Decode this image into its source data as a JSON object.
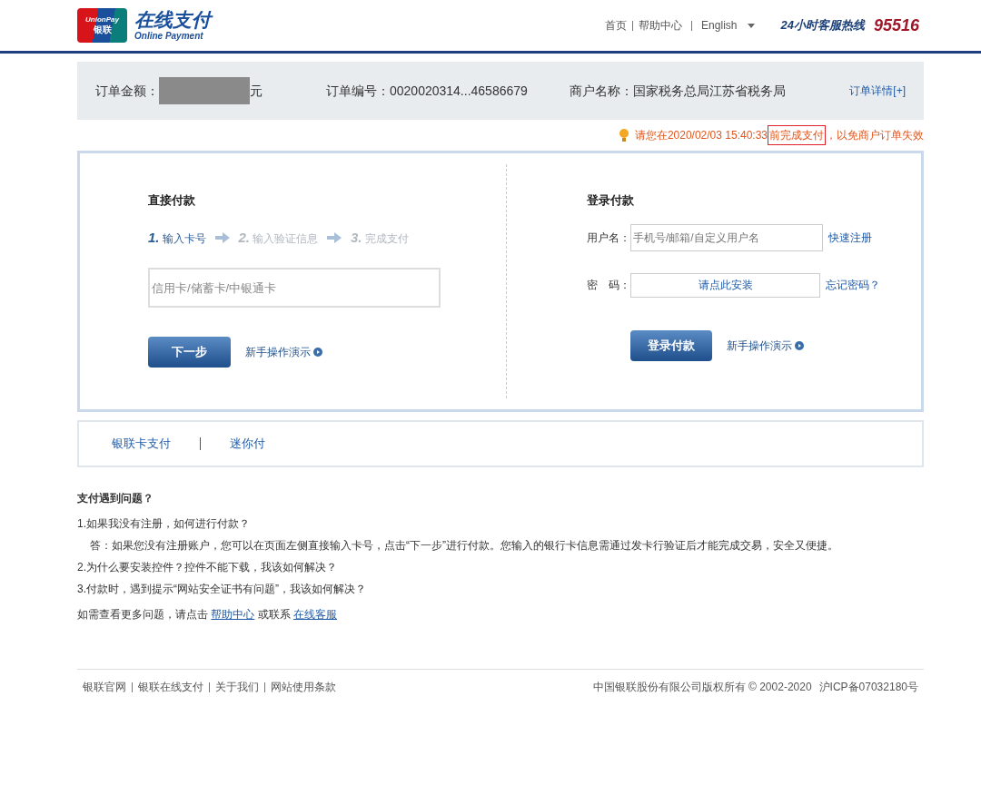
{
  "header": {
    "logo": {
      "mark_top": "UnionPay",
      "mark_bottom": "银联",
      "title": "在线支付",
      "subtitle": "Online Payment"
    },
    "nav": [
      "首页",
      "帮助中心"
    ],
    "language": "English",
    "hotline_label": "24小时客服热线",
    "hotline": "95516"
  },
  "order": {
    "amount_label": "订单金额：",
    "amount_unit": "元",
    "number_label": "订单编号：",
    "number": "0020020314...46586679",
    "merchant_label": "商户名称：",
    "merchant": "国家税务总局江苏省税务局",
    "details_link": "订单详情[+]"
  },
  "notice": {
    "before": "请您在2020/02/03 15:40:33",
    "highlight": "前完成支付",
    "after": "，以免商户订单失效"
  },
  "direct_pay": {
    "title": "直接付款",
    "steps": [
      {
        "number": "1.",
        "label": "输入卡号",
        "selected": true
      },
      {
        "number": "2.",
        "label": "输入验证信息",
        "selected": false
      },
      {
        "number": "3.",
        "label": "完成支付",
        "selected": false
      }
    ],
    "card_field": {
      "placeholder": "信用卡/储蓄卡/中银通卡"
    },
    "button": "下一步",
    "demo_link": "新手操作演示"
  },
  "login_pay": {
    "title": "登录付款",
    "username_label": "用户名：",
    "username_field": {
      "placeholder": "手机号/邮箱/自定义用户名"
    },
    "register_link": "快速注册",
    "password_label": "密　码：",
    "password_field": "请点此安装",
    "forgot_link": "忘记密码？",
    "button": "登录付款",
    "demo_link": "新手操作演示"
  },
  "pay_tabs": [
    "银联卡支付",
    "迷你付"
  ],
  "faq": {
    "title": "支付遇到问题？",
    "items": [
      {
        "question": "1.如果我没有注册，如何进行付款？",
        "answer": "答：如果您没有注册账户，您可以在页面左侧直接输入卡号，点击“下一步”进行付款。您输入的银行卡信息需通过发卡行验证后才能完成交易，安全又便捷。"
      },
      {
        "question": "2.为什么要安装控件？控件不能下载，我该如何解决？"
      },
      {
        "question": "3.付款时，遇到提示“网站安全证书有问题”，我该如何解决？"
      }
    ],
    "more_text": "如需查看更多问题，请点击",
    "help_link": "帮助中心",
    "contact_text": "或联系",
    "service_link": "在线客服"
  },
  "footer": {
    "links": [
      "银联官网",
      "银联在线支付",
      "关于我们",
      "网站使用条款"
    ],
    "copyright": "中国银联股份有限公司版权所有 © 2002-2020",
    "icp": "沪ICP备07032180号"
  }
}
